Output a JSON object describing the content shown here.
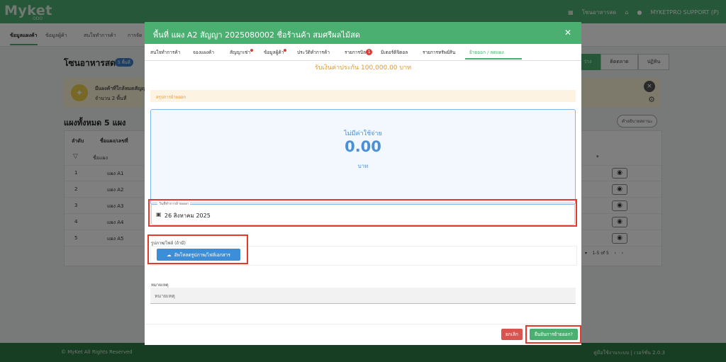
{
  "app": {
    "brand": "Myket",
    "brand_sub": "ODO",
    "market_name": "โซนอาหารสด",
    "user": "MYKETPRO SUPPORT (P)"
  },
  "subnav": {
    "tabs": [
      "ข้อมูลแผงค้า",
      "ข้อมูลผู้ค้า",
      "สนใจทำการค้า",
      "การจัด"
    ]
  },
  "page": {
    "title": "โซนอาหารสด",
    "badge": "5 พื้นที่",
    "view_buttons": [
      "ว่าง",
      "ติดตลาด",
      "ปฏิทิน"
    ],
    "alert_title": "มีแผงค้าที่ใกล้หมดสัญญา",
    "alert_count": "จำนวน 2 พื้นที่",
    "section_title": "แผงทั้งหมด 5 แผง",
    "help_label": "คำอธิบายสถานะ",
    "table_headers": [
      "ลำดับ",
      "ชื่อแผง/เลขที่"
    ],
    "filter_placeholder": "ชื่อแผง",
    "rows": [
      {
        "num": "1",
        "name": "แผง A1"
      },
      {
        "num": "2",
        "name": "แผง A2"
      },
      {
        "num": "3",
        "name": "แผง A3"
      },
      {
        "num": "4",
        "name": "แผง A4"
      },
      {
        "num": "5",
        "name": "แผง A5"
      }
    ],
    "pager": "1-5 of 5"
  },
  "footer": {
    "copyright": "© MyKet All Rights Reserved",
    "right": "คู่มือใช้งานระบบ | เวอร์ชั่น 2.0.3"
  },
  "modal": {
    "title": "พื้นที่ แผง A2 สัญญา 2025080002 ชื่อร้านค้า สมศรีผลไม้สด",
    "tabs": [
      {
        "label": "สนใจทำการค้า",
        "mark": ""
      },
      {
        "label": "จองแผงค้า",
        "mark": ""
      },
      {
        "label": "สัญญาเช่า",
        "mark": "dot"
      },
      {
        "label": "ข้อมูลผู้ค้า",
        "mark": "dot"
      },
      {
        "label": "ประวัติทำการค้า",
        "mark": ""
      },
      {
        "label": "รายการบิล",
        "mark": "1"
      },
      {
        "label": "มิเตอร์ดิจิตอล",
        "mark": ""
      },
      {
        "label": "รายการทรัพย์สิน",
        "mark": ""
      },
      {
        "label": "ย้ายออก / ลดแผง",
        "mark": ""
      }
    ],
    "deposit": "รับเงินค่าประกัน 100,000.00 บาท",
    "summary_label": "สรุปการย้ายออก",
    "cost_label": "ไม่มีค่าใช้จ่าย",
    "cost_amount": "0.00",
    "cost_unit": "บาท",
    "date_label": "วันที่ทำการย้ายออก",
    "date_value": "26 สิงหาคม 2025",
    "upload_label": "รูปภาพ/ไฟล์ (ถ้ามี)",
    "upload_button": "อัพโหลดรูปภาพ/ไฟล์เอกสาร",
    "note_label": "หมายเหตุ",
    "note_placeholder": "หมายเหตุ",
    "cancel": "ยกเลิก",
    "confirm": "ยืนยันการย้ายออก?"
  },
  "colors": {
    "brand_green": "#4caf72",
    "highlight_red": "#e53a2a",
    "cost_blue": "#4a90d9",
    "deposit_orange": "#e09a2a"
  }
}
